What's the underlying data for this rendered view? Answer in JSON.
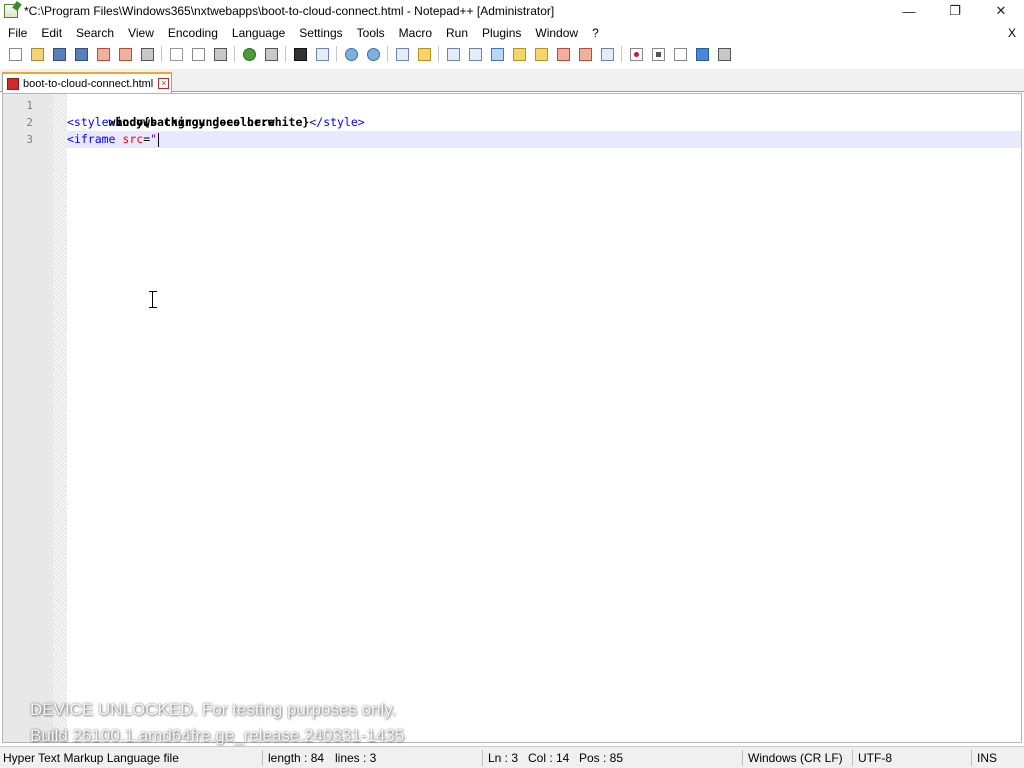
{
  "window": {
    "title": "*C:\\Program Files\\Windows365\\nxtwebapps\\boot-to-cloud-connect.html - Notepad++ [Administrator]",
    "minimize_glyph": "—",
    "restore_glyph": "❐",
    "close_glyph": "✕"
  },
  "menu": {
    "items": [
      "File",
      "Edit",
      "Search",
      "View",
      "Encoding",
      "Language",
      "Settings",
      "Tools",
      "Macro",
      "Run",
      "Plugins",
      "Window",
      "?"
    ],
    "close_label": "X"
  },
  "toolbar": {
    "icons": [
      "new-file-icon",
      "open-file-icon",
      "save-icon",
      "save-all-icon",
      "close-icon",
      "close-all-icon",
      "print-icon",
      "cut-icon",
      "copy-icon",
      "paste-icon",
      "undo-icon",
      "redo-icon",
      "find-icon",
      "replace-icon",
      "zoom-in-icon",
      "zoom-out-icon",
      "sync-vertical-icon",
      "sync-horizontal-icon",
      "word-wrap-icon",
      "show-all-chars-icon",
      "indent-guide-icon",
      "language-udl-icon",
      "document-map-icon",
      "function-list-icon",
      "folder-workspace-icon",
      "monitoring-icon",
      "record-macro-icon",
      "stop-record-icon",
      "play-macro-icon",
      "run-macro-multiple-icon",
      "save-macro-icon"
    ]
  },
  "tab": {
    "label": "boot-to-cloud-connect.html",
    "close_glyph": "×"
  },
  "editor": {
    "line_numbers": [
      "1",
      "2",
      "3"
    ],
    "line1": {
      "text": "windows thingy goes here"
    },
    "line2": {
      "open_tag": "<style>",
      "content": "body{background-color:white}",
      "close_tag": "</style>"
    },
    "line3": {
      "open_bracket": "<",
      "tag_name": "iframe",
      "attr_name": "src",
      "equals": "=",
      "string": "\""
    }
  },
  "watermark": {
    "line1": "DEVICE UNLOCKED. For testing purposes only.",
    "line2": "Build 26100.1.amd64fre.ge_release.240331-1435"
  },
  "status": {
    "file_type": "Hyper Text Markup Language file",
    "length": "length : 84",
    "lines": "lines : 3",
    "ln": "Ln : 3",
    "col": "Col : 14",
    "pos": "Pos : 85",
    "eol": "Windows (CR LF)",
    "encoding": "UTF-8",
    "ins": "INS"
  }
}
